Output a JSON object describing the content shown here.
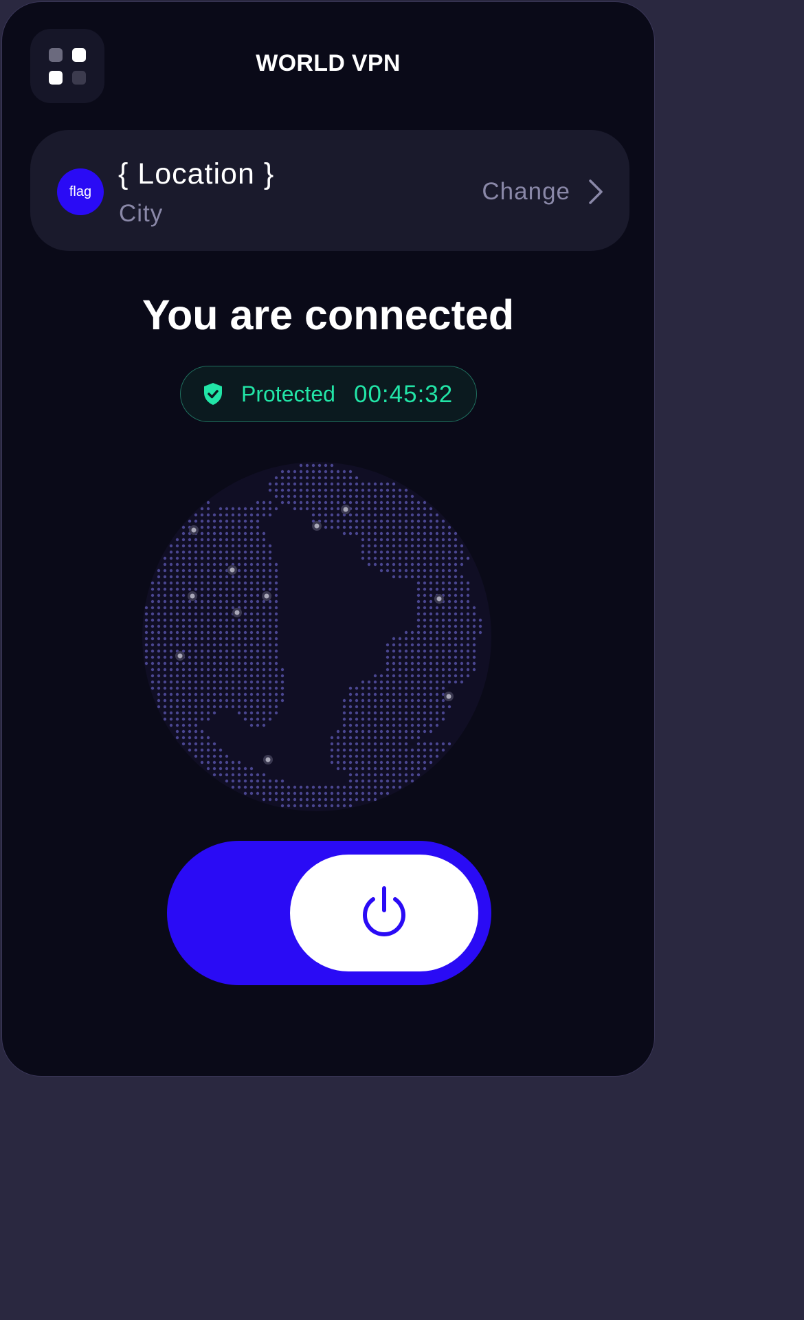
{
  "header": {
    "title": "WORLD VPN",
    "menu_icon": "grid-menu-icon"
  },
  "location": {
    "flag_text": "flag",
    "name": "{ Location }",
    "city": "City",
    "change_label": "Change",
    "change_icon": "chevron-right-icon"
  },
  "status": {
    "title": "You are connected",
    "badge_label": "Protected",
    "timer": "00:45:32",
    "badge_icon": "shield-check-icon"
  },
  "connection": {
    "is_on": true,
    "toggle_icon": "power-icon"
  },
  "colors": {
    "background": "#0a0a18",
    "card": "#1a1a2c",
    "accent": "#2a0bf5",
    "success": "#22e5a7",
    "muted_text": "#8a88a8"
  }
}
